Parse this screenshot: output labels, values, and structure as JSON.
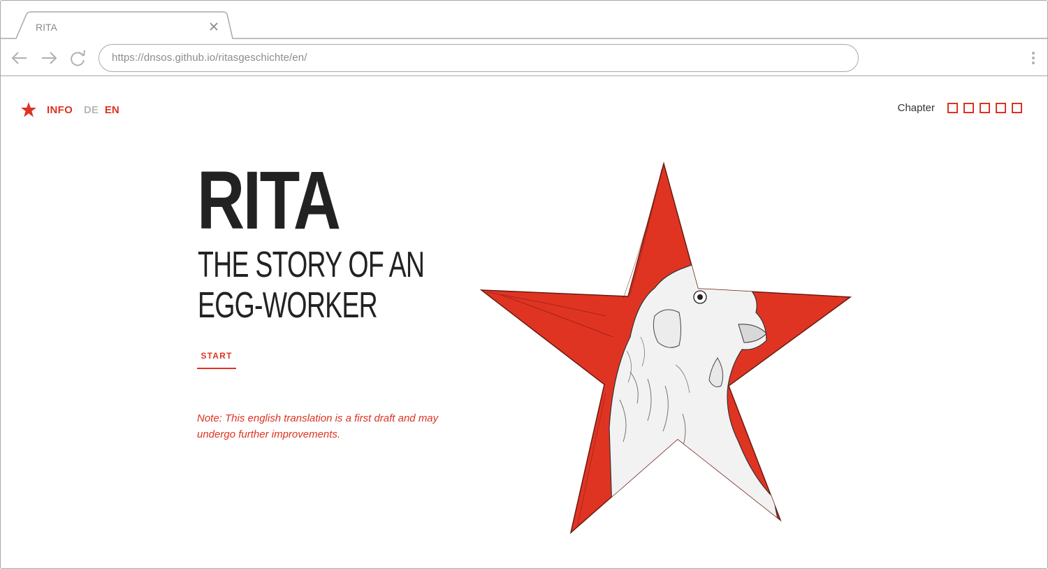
{
  "browser": {
    "tab_title": "RITA",
    "url": "https://dnsos.github.io/ritasgeschichte/en/"
  },
  "nav": {
    "info": "INFO",
    "lang_de": "DE",
    "lang_en": "EN"
  },
  "chapters": {
    "label": "Chapter",
    "count": 5
  },
  "hero": {
    "title": "RITA",
    "subtitle_line1": "THE STORY OF AN",
    "subtitle_line2": "EGG-WORKER",
    "start": "START",
    "note": "Note: This english translation is a first draft and may undergo further improvements."
  },
  "colors": {
    "accent": "#dc3322",
    "text": "#222222",
    "muted": "#b8b8b8"
  },
  "icons": [
    "star-logo-icon",
    "back-arrow-icon",
    "forward-arrow-icon",
    "reload-icon",
    "close-icon",
    "menu-dots-icon"
  ]
}
